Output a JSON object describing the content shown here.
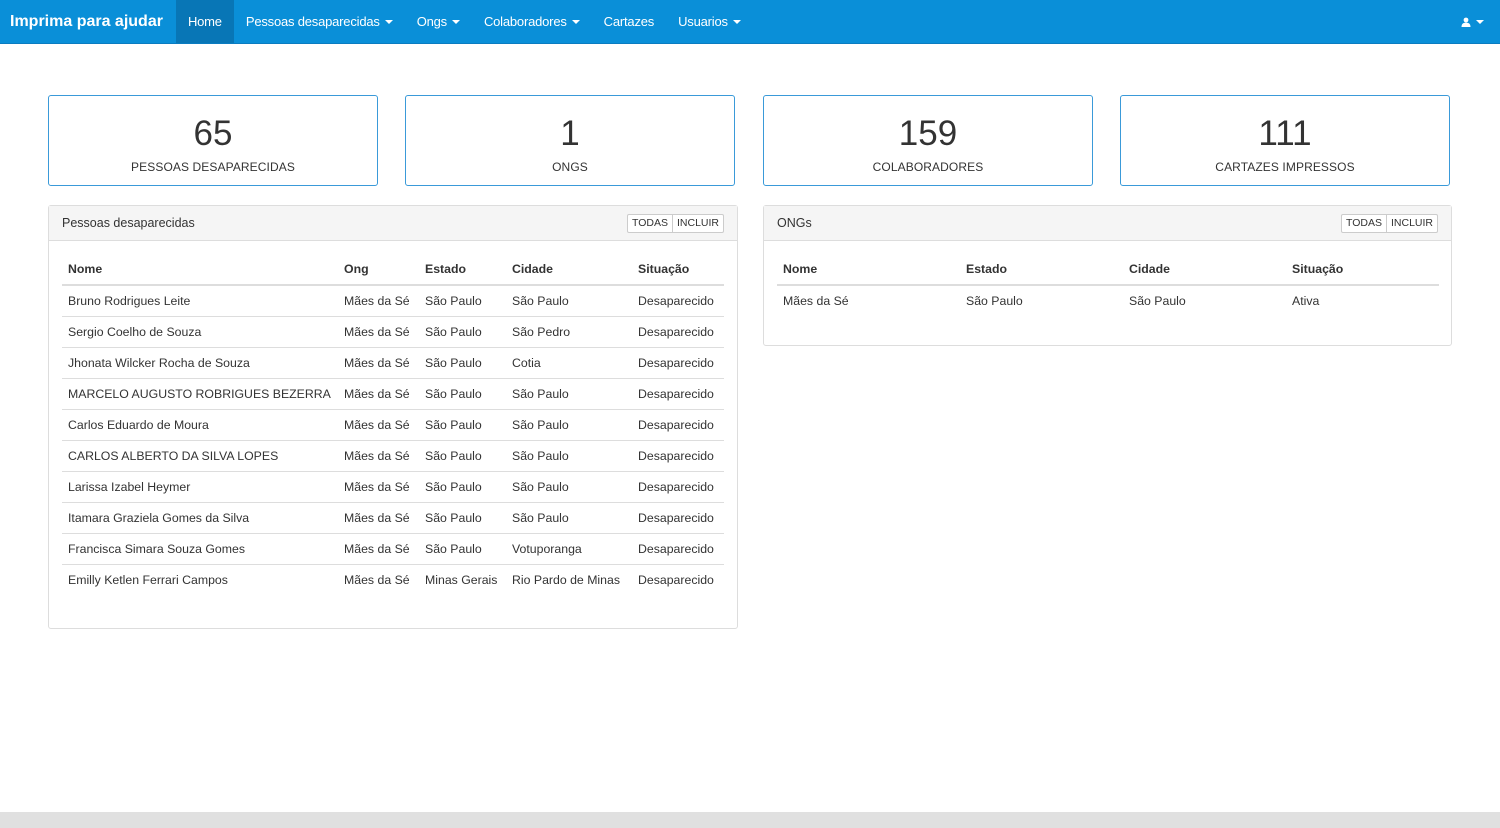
{
  "navbar": {
    "brand": "Imprima para ajudar",
    "items": [
      {
        "label": "Home",
        "active": true,
        "dropdown": false
      },
      {
        "label": "Pessoas desaparecidas",
        "dropdown": true
      },
      {
        "label": "Ongs",
        "dropdown": true
      },
      {
        "label": "Colaboradores",
        "dropdown": true
      },
      {
        "label": "Cartazes",
        "dropdown": false
      },
      {
        "label": "Usuarios",
        "dropdown": true
      }
    ],
    "user_icon": "user-icon"
  },
  "stats": [
    {
      "value": "65",
      "label": "PESSOAS DESAPARECIDAS"
    },
    {
      "value": "1",
      "label": "ONGS"
    },
    {
      "value": "159",
      "label": "COLABORADORES"
    },
    {
      "value": "111",
      "label": "CARTAZES IMPRESSOS"
    }
  ],
  "missing_panel": {
    "title": "Pessoas desaparecidas",
    "btn_all": "TODAS",
    "btn_add": "INCLUIR",
    "columns": [
      "Nome",
      "Ong",
      "Estado",
      "Cidade",
      "Situação"
    ],
    "rows": [
      [
        "Bruno Rodrigues Leite",
        "Mães da Sé",
        "São Paulo",
        "São Paulo",
        "Desaparecido"
      ],
      [
        "Sergio Coelho de Souza",
        "Mães da Sé",
        "São Paulo",
        "São Pedro",
        "Desaparecido"
      ],
      [
        "Jhonata Wilcker Rocha de Souza",
        "Mães da Sé",
        "São Paulo",
        "Cotia",
        "Desaparecido"
      ],
      [
        "MARCELO AUGUSTO ROBRIGUES BEZERRA",
        "Mães da Sé",
        "São Paulo",
        "São Paulo",
        "Desaparecido"
      ],
      [
        "Carlos Eduardo de Moura",
        "Mães da Sé",
        "São Paulo",
        "São Paulo",
        "Desaparecido"
      ],
      [
        "CARLOS ALBERTO DA SILVA LOPES",
        "Mães da Sé",
        "São Paulo",
        "São Paulo",
        "Desaparecido"
      ],
      [
        "Larissa Izabel Heymer",
        "Mães da Sé",
        "São Paulo",
        "São Paulo",
        "Desaparecido"
      ],
      [
        "Itamara Graziela Gomes da Silva",
        "Mães da Sé",
        "São Paulo",
        "São Paulo",
        "Desaparecido"
      ],
      [
        "Francisca Simara Souza Gomes",
        "Mães da Sé",
        "São Paulo",
        "Votuporanga",
        "Desaparecido"
      ],
      [
        "Emilly Ketlen Ferrari Campos",
        "Mães da Sé",
        "Minas Gerais",
        "Rio Pardo de Minas",
        "Desaparecido"
      ]
    ]
  },
  "ongs_panel": {
    "title": "ONGs",
    "btn_all": "TODAS",
    "btn_add": "INCLUIR",
    "columns": [
      "Nome",
      "Estado",
      "Cidade",
      "Situação"
    ],
    "rows": [
      [
        "Mães da Sé",
        "São Paulo",
        "São Paulo",
        "Ativa"
      ]
    ]
  }
}
